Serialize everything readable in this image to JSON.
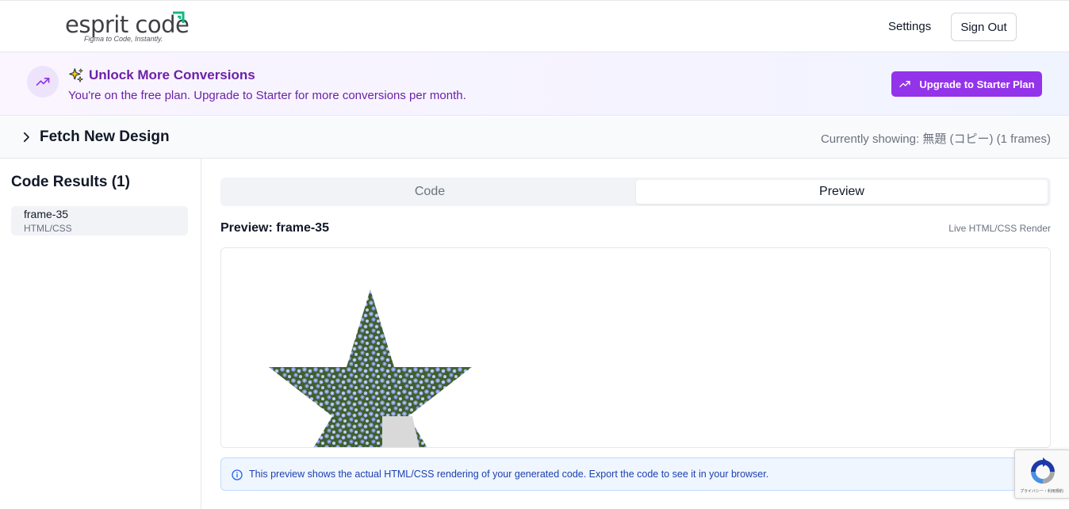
{
  "header": {
    "logo_text": "esprit code",
    "logo_tagline": "Figma to Code, Instantly.",
    "settings_label": "Settings",
    "signout_label": "Sign Out"
  },
  "banner": {
    "title": "Unlock More Conversions",
    "subtitle": "You're on the free plan. Upgrade to Starter for more conversions per month.",
    "upgrade_label": "Upgrade to Starter Plan"
  },
  "fetch": {
    "title": "Fetch New Design",
    "status": "Currently showing: 無題 (コピー) (1 frames)"
  },
  "sidebar": {
    "title": "Code Results (1)",
    "items": [
      {
        "name": "frame-35",
        "type": "HTML/CSS"
      }
    ]
  },
  "tabs": {
    "code_label": "Code",
    "preview_label": "Preview",
    "active": "Preview"
  },
  "preview": {
    "heading": "Preview: frame-35",
    "render_label": "Live HTML/CSS Render"
  },
  "info": {
    "text": "This preview shows the actual HTML/CSS rendering of your generated code. Export the code to see it in your browser."
  },
  "recaptcha": {
    "text": "プライバシー・利用規約"
  },
  "colors": {
    "brand_purple": "#9333ea",
    "banner_text": "#6b21a8",
    "logo_green": "#10b981",
    "info_blue": "#1e40af"
  }
}
